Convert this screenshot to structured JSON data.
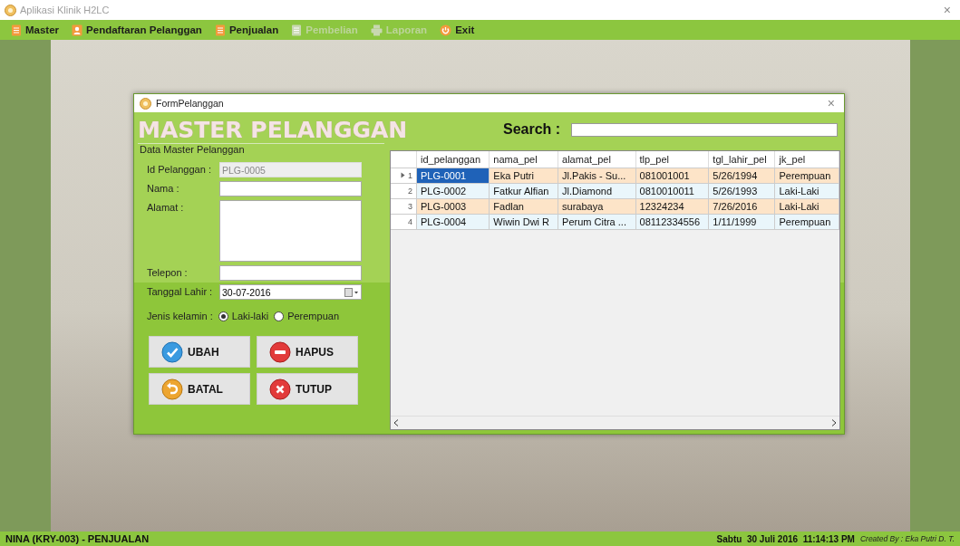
{
  "window": {
    "title": "Aplikasi Klinik H2LC",
    "close": "×"
  },
  "menu": [
    {
      "label": "Master",
      "disabled": false,
      "kind": "doc"
    },
    {
      "label": "Pendaftaran Pelanggan",
      "disabled": false,
      "kind": "person"
    },
    {
      "label": "Penjualan",
      "disabled": false,
      "kind": "doc"
    },
    {
      "label": "Pembelian",
      "disabled": true,
      "kind": "doc"
    },
    {
      "label": "Laporan",
      "disabled": true,
      "kind": "printer"
    },
    {
      "label": "Exit",
      "disabled": false,
      "kind": "power"
    }
  ],
  "dialog": {
    "title": "FormPelanggan",
    "close": "×",
    "heading": "MASTER PELANGGAN",
    "search": {
      "label": "Search :"
    },
    "group": "Data Master Pelanggan",
    "fields": [
      {
        "label": "Id Pelanggan :",
        "value": "PLG-0005",
        "kind": "text",
        "disabled": true
      },
      {
        "label": "Nama :",
        "kind": "text",
        "disabled": false
      },
      {
        "label": "Alamat :",
        "kind": "textarea",
        "disabled": false
      },
      {
        "label": "Telepon :",
        "kind": "text",
        "disabled": false
      },
      {
        "label": "Tanggal Lahir :",
        "value": "30-07-2016",
        "kind": "date",
        "disabled": false
      }
    ],
    "gender": {
      "label": "Jenis kelamin :",
      "options": [
        {
          "label": "Laki-laki",
          "selected": true
        },
        {
          "label": "Perempuan",
          "selected": false
        }
      ]
    },
    "buttons": [
      {
        "label": "UBAH",
        "kind": "check"
      },
      {
        "label": "HAPUS",
        "kind": "minus"
      },
      {
        "label": "BATAL",
        "kind": "undo"
      },
      {
        "label": "TUTUP",
        "kind": "cross"
      }
    ],
    "table": {
      "columns": [
        "id_pelanggan",
        "nama_pel",
        "alamat_pel",
        "tlp_pel",
        "tgl_lahir_pel",
        "jk_pel"
      ],
      "rows": [
        {
          "number": "1",
          "selected": true,
          "cells": [
            "PLG-0001",
            "Eka Putri",
            "Jl.Pakis - Su...",
            "081001001",
            "5/26/1994",
            "Perempuan"
          ]
        },
        {
          "number": "2",
          "selected": false,
          "cells": [
            "PLG-0002",
            "Fatkur Alfian",
            "Jl.Diamond",
            "0810010011",
            "5/26/1993",
            "Laki-Laki"
          ]
        },
        {
          "number": "3",
          "selected": false,
          "cells": [
            "PLG-0003",
            "Fadlan",
            "surabaya",
            "12324234",
            "7/26/2016",
            "Laki-Laki"
          ]
        },
        {
          "number": "4",
          "selected": false,
          "cells": [
            "PLG-0004",
            "Wiwin Dwi R",
            "Perum Citra ...",
            "08112334556",
            "1/11/1999",
            "Perempuan"
          ]
        }
      ]
    }
  },
  "status_bar": {
    "user": "NINA (KRY-003) - PENJUALAN",
    "datetime": "Sabtu  30 Juli 2016  11:14:13 PM",
    "credit": "Created By : Eka Putri D. T."
  }
}
